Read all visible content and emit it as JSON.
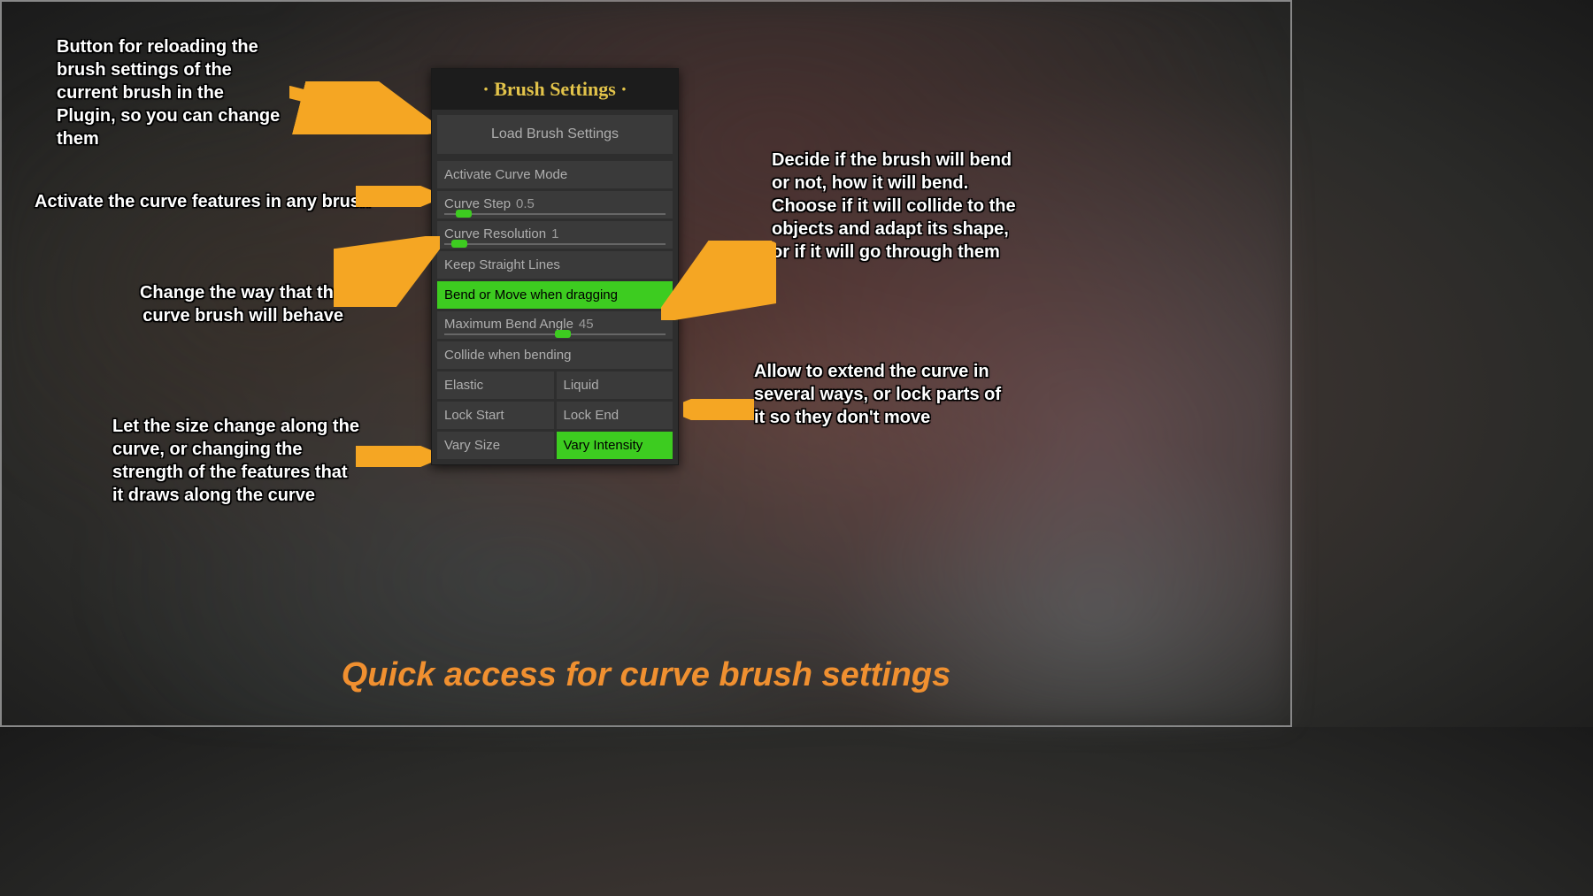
{
  "panel": {
    "title": "· Brush Settings ·",
    "load_button": "Load Brush Settings",
    "activate_curve": "Activate Curve Mode",
    "curve_step": {
      "label": "Curve Step",
      "value": "0.5",
      "pct": 5
    },
    "curve_resolution": {
      "label": "Curve Resolution",
      "value": "1",
      "pct": 3
    },
    "keep_straight": "Keep Straight Lines",
    "bend_or_move": "Bend or Move when dragging",
    "max_bend": {
      "label": "Maximum Bend Angle",
      "value": "45",
      "pct": 50
    },
    "collide": "Collide when bending",
    "elastic": "Elastic",
    "liquid": "Liquid",
    "lock_start": "Lock Start",
    "lock_end": "Lock End",
    "vary_size": "Vary Size",
    "vary_intensity": "Vary Intensity"
  },
  "annotations": {
    "reload": "Button for reloading the brush settings of the current brush in the Plugin, so you can change them",
    "activate": "Activate the curve features in any brush",
    "behave": "Change the way that the curve brush will behave",
    "bend": "Decide if the brush will bend or not, how it will bend. Choose if it will collide to the objects and adapt its shape, or if it will go through them",
    "extend": "Allow to extend the curve in several ways, or lock parts of it so they don't move",
    "vary": "Let the size change along the curve, or changing the strength of the features that it draws along the curve"
  },
  "footer": "Quick access for curve brush settings",
  "colors": {
    "accent": "#e2c34a",
    "active": "#3dcc20",
    "arrow": "#f5a623",
    "footer": "#f09030"
  }
}
